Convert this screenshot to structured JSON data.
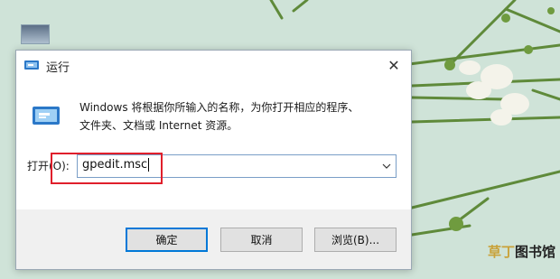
{
  "dialog": {
    "title": "运行",
    "description_line1": "Windows 将根据你所输入的名称，为你打开相应的程序、",
    "description_line2": "文件夹、文档或 Internet 资源。",
    "open_label": "打开(O):",
    "input_value": "gpedit.msc",
    "buttons": {
      "ok": "确定",
      "cancel": "取消",
      "browse": "浏览(B)..."
    }
  },
  "watermark": {
    "part1": "草丁",
    "part2": "图书馆"
  },
  "colors": {
    "highlight": "#e01f2b",
    "focus": "#0078d7"
  }
}
